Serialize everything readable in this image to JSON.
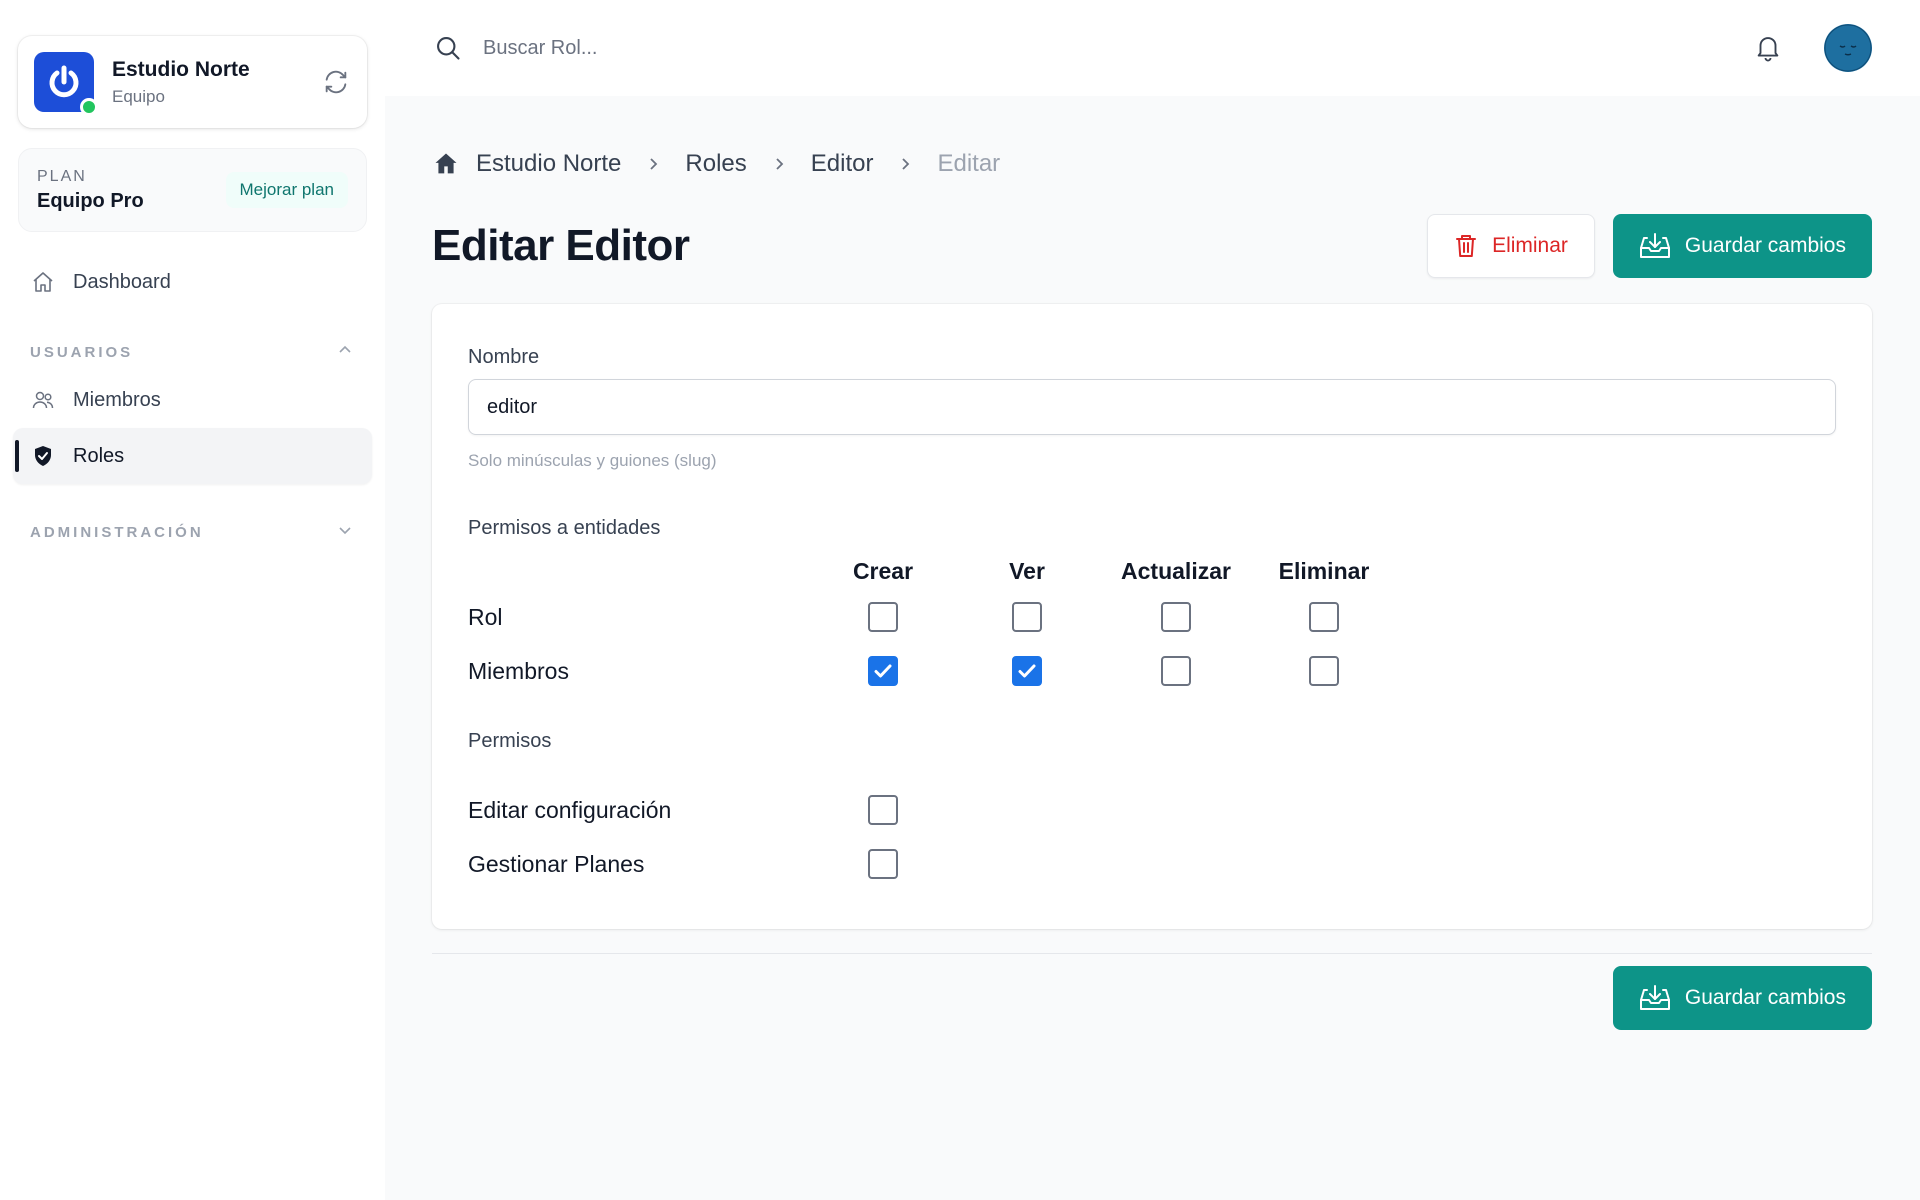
{
  "team": {
    "name": "Estudio Norte",
    "type": "Equipo"
  },
  "plan": {
    "label": "PLAN",
    "name": "Equipo Pro",
    "upgrade_label": "Mejorar plan"
  },
  "sidebar": {
    "dashboard_label": "Dashboard",
    "section_users": "USUARIOS",
    "members_label": "Miembros",
    "roles_label": "Roles",
    "section_admin": "ADMINISTRACIÓN"
  },
  "topbar": {
    "search_placeholder": "Buscar Rol..."
  },
  "breadcrumb": [
    "Estudio Norte",
    "Roles",
    "Editor",
    "Editar"
  ],
  "page": {
    "title": "Editar Editor",
    "delete_label": "Eliminar",
    "save_label": "Guardar cambios"
  },
  "form": {
    "name_label": "Nombre",
    "name_value": "editor",
    "name_hint": "Solo minúsculas y guiones (slug)",
    "entity_perms_label": "Permisos a entidades",
    "columns": [
      "Crear",
      "Ver",
      "Actualizar",
      "Eliminar"
    ],
    "entity_rows": [
      {
        "label": "Rol",
        "values": [
          false,
          false,
          false,
          false
        ]
      },
      {
        "label": "Miembros",
        "values": [
          true,
          true,
          false,
          false
        ]
      }
    ],
    "perms_label": "Permisos",
    "perm_rows": [
      {
        "label": "Editar configuración",
        "checked": false
      },
      {
        "label": "Gestionar Planes",
        "checked": false
      }
    ]
  },
  "colors": {
    "primary": "#0d9488",
    "danger": "#dc2626",
    "checkbox": "#1a73e8",
    "team_logo": "#1d4ed8"
  }
}
